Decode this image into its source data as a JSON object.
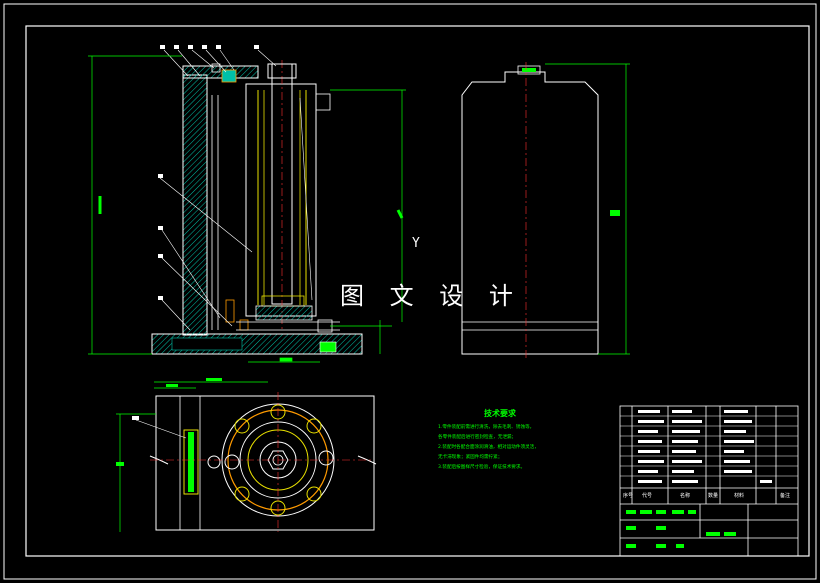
{
  "watermark": "图 文 设 计",
  "axis_label": "Y",
  "tech_requirements": {
    "title": "技术要求",
    "lines": [
      "1.零件装配前需进行清洗，除去毛刺、锈蚀等，",
      "各零件装配后进行密封检查，无泄漏；",
      "2.装配时各配合面涂润滑油，相对运动件须灵活，",
      "无卡滞现象；紧固件均需拧紧；",
      "3.装配后按图样尺寸检验，保证技术要求。"
    ]
  },
  "title_block": {
    "headers": [
      "序号",
      "代号",
      "名称",
      "数量",
      "材料",
      "备注"
    ]
  },
  "colors": {
    "background": "#000000",
    "frame": "#ffffff",
    "dimension": "#00ff00",
    "hatch": "#00c0a8",
    "centerline": "#ff3030",
    "part_yellow": "#e8e000",
    "part_orange": "#ff9a00",
    "white": "#ffffff"
  }
}
